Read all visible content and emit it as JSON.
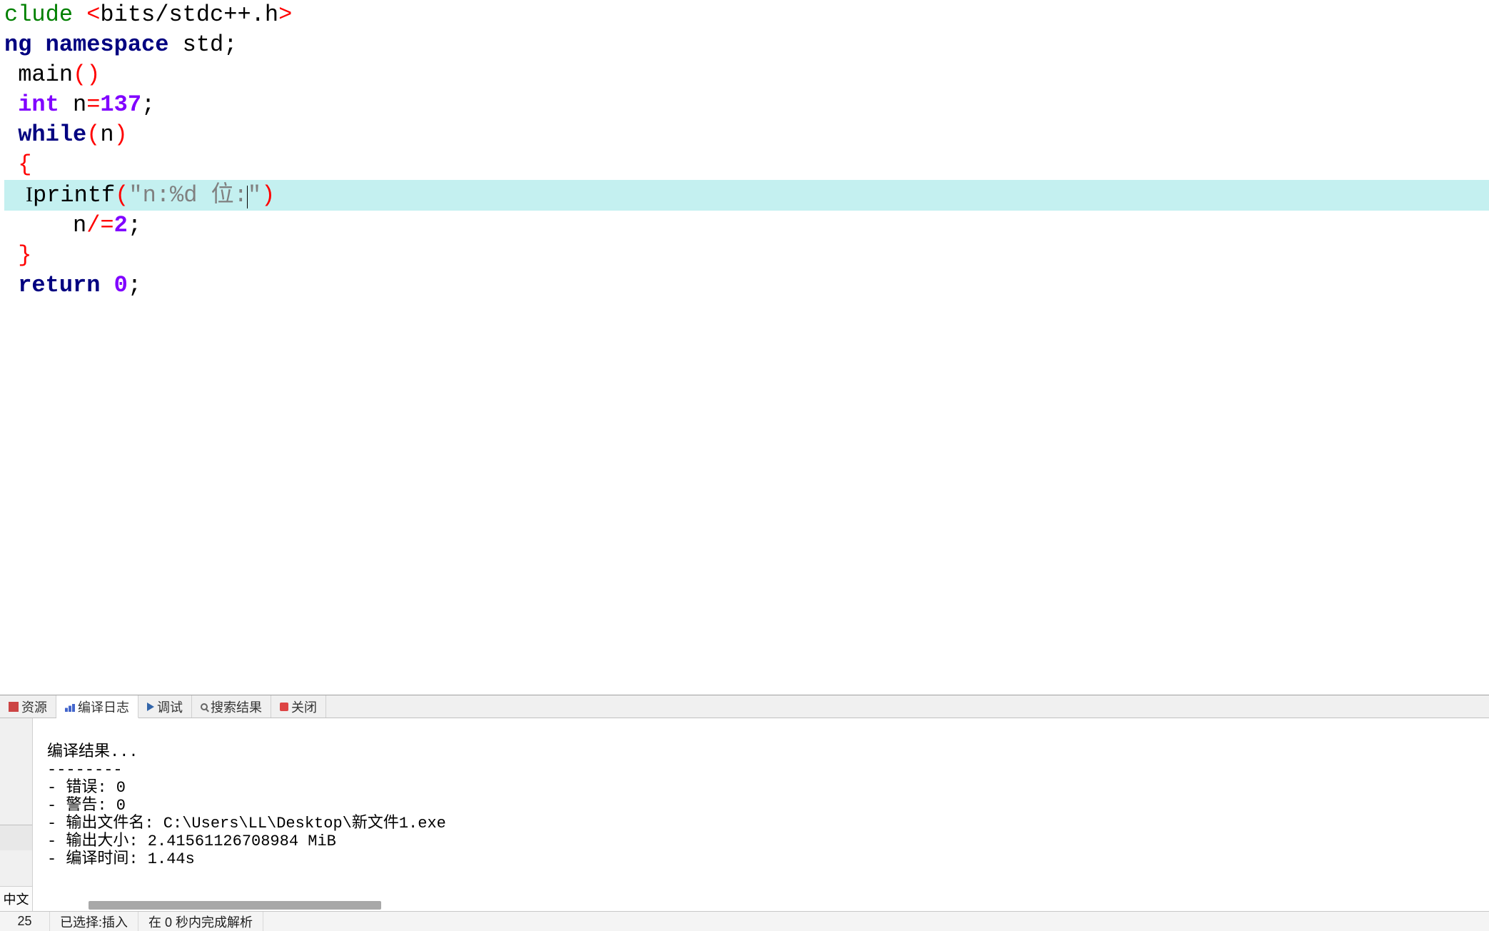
{
  "code": {
    "line1_preproc": "clude ",
    "line1_angle_open": "<",
    "line1_header": "bits/stdc++.h",
    "line1_angle_close": ">",
    "line2_using": "ng ",
    "line2_namespace": "namespace",
    "line2_std": " std",
    "line2_semi": ";",
    "line3_main": " main",
    "line3_paren": "()",
    "line4_blank": "",
    "line5_int": " int",
    "line5_var": " n",
    "line5_eq": "=",
    "line5_num": "137",
    "line5_semi": ";",
    "line6_while": " while",
    "line6_popen": "(",
    "line6_n": "n",
    "line6_pclose": ")",
    "line7_brace": " {",
    "line8_ibeam": "    I",
    "line8_printf": "printf",
    "line8_popen": "(",
    "line8_q1": "\"",
    "line8_str": "n:%d 位:",
    "line8_q2": "\"",
    "line8_pclose": ")",
    "line9_indent": "     n",
    "line9_op": "/=",
    "line9_num": "2",
    "line9_semi": ";",
    "line10_brace": " }",
    "line11_return": " return",
    "line11_sp": " ",
    "line11_num": "0",
    "line11_semi": ";"
  },
  "tabs": {
    "t0": "资源",
    "t1": "编译日志",
    "t2": "调试",
    "t3": "搜索结果",
    "t4": "关闭"
  },
  "side": {
    "lang": "中文"
  },
  "log": {
    "l1": "编译结果...",
    "l2": "--------",
    "l3": "- 错误: 0",
    "l4": "- 警告: 0",
    "l5": "- 输出文件名: C:\\Users\\LL\\Desktop\\新文件1.exe",
    "l6": "- 输出大小: 2.41561126708984 MiB",
    "l7": "- 编译时间: 1.44s"
  },
  "status": {
    "col": "25",
    "sel": "已选择:插入",
    "parse": "在 0 秒内完成解析"
  }
}
